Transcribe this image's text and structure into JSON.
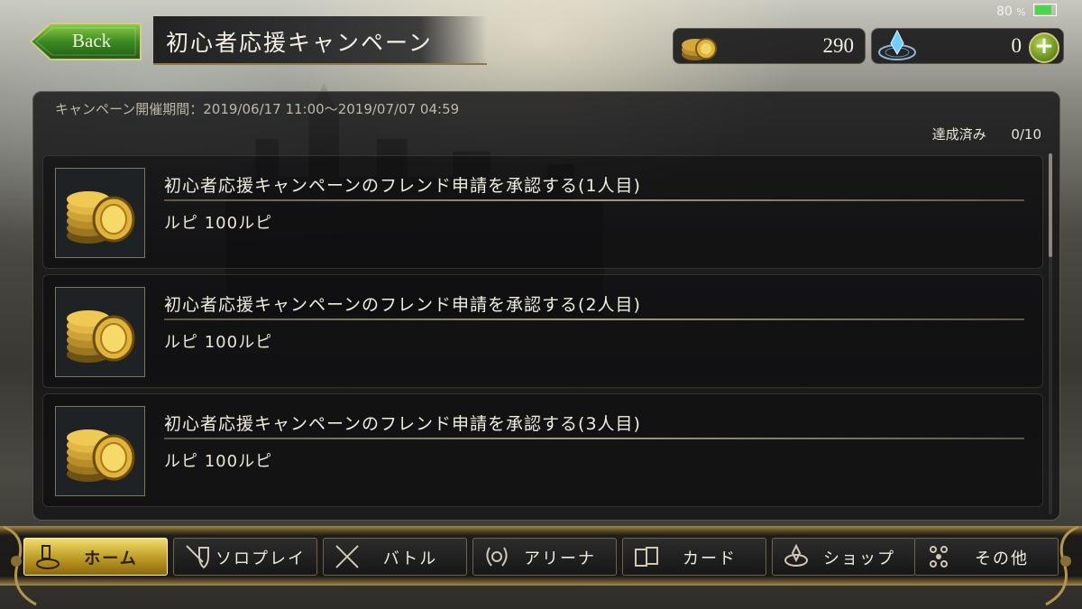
{
  "status": {
    "battery": "80",
    "battery_unit": "%",
    "battery_level": 0.8
  },
  "header": {
    "back_label": "Back",
    "title": "初心者応援キャンペーン"
  },
  "currencies": {
    "rupies": "290",
    "crystals": "0",
    "add_label": "+"
  },
  "campaign": {
    "period": "キャンペーン開催期間：2019/06/17 11:00〜2019/07/07 04:59",
    "achieved_label": "達成済み",
    "achieved_value": "0/10"
  },
  "missions": [
    {
      "title": "初心者応援キャンペーンのフレンド申請を承認する(1人目)",
      "reward": "ルピ 100ルピ",
      "icon": "gold-coins"
    },
    {
      "title": "初心者応援キャンペーンのフレンド申請を承認する(2人目)",
      "reward": "ルピ 100ルピ",
      "icon": "gold-coins"
    },
    {
      "title": "初心者応援キャンペーンのフレンド申請を承認する(3人目)",
      "reward": "ルピ 100ルピ",
      "icon": "gold-coins"
    }
  ],
  "nav": [
    {
      "label": "ホーム",
      "icon": "home-icon",
      "active": true
    },
    {
      "label": "ソロプレイ",
      "icon": "sword-shield-icon",
      "active": false
    },
    {
      "label": "バトル",
      "icon": "crossed-swords-icon",
      "active": false
    },
    {
      "label": "アリーナ",
      "icon": "laurel-icon",
      "active": false
    },
    {
      "label": "カード",
      "icon": "cards-icon",
      "active": false
    },
    {
      "label": "ショップ",
      "icon": "shop-crystal-icon",
      "active": false
    },
    {
      "label": "その他",
      "icon": "other-icon",
      "active": false
    }
  ],
  "colors": {
    "gold": "#c9a13a",
    "active_tab": "#e2c24a",
    "plus_green": "#7fae2a",
    "back_green": "#4f8f2c"
  }
}
